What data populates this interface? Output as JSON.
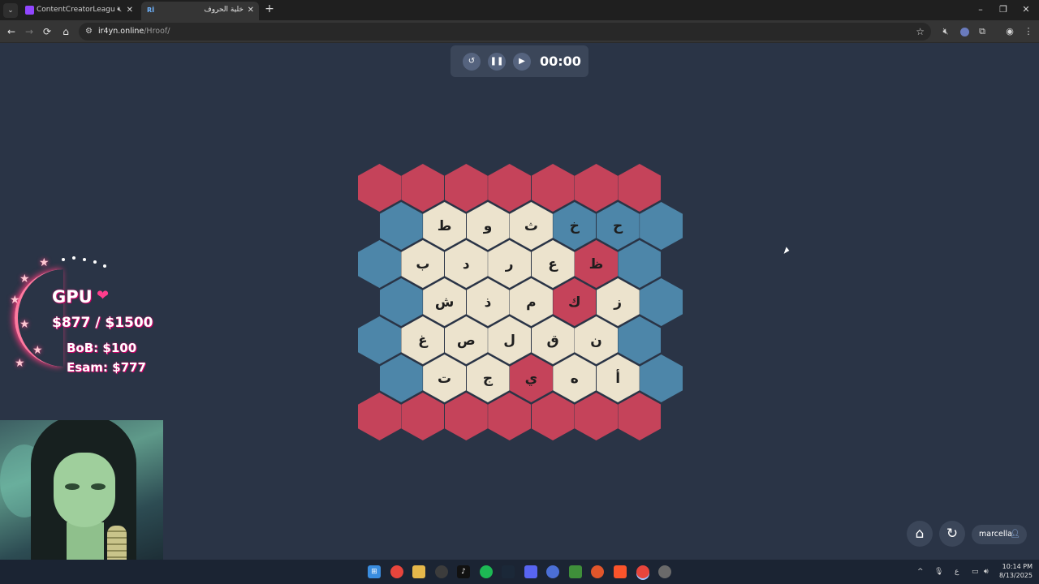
{
  "browser": {
    "tabs": [
      {
        "title": "ContentCreatorLeague - Tw",
        "active": false,
        "muted": true
      },
      {
        "title": "خلية الحروف",
        "active": true
      }
    ],
    "address": {
      "domain": "ir4yn.online",
      "path": "/Hroof/"
    }
  },
  "timer": {
    "time": "00:00"
  },
  "board": {
    "colors": {
      "red": "#c5435a",
      "blue": "#4d86a9",
      "cream": "#ece3cd"
    },
    "rows": [
      [
        {
          "c": "red",
          "t": ""
        },
        {
          "c": "red",
          "t": ""
        },
        {
          "c": "red",
          "t": ""
        },
        {
          "c": "red",
          "t": ""
        },
        {
          "c": "red",
          "t": ""
        },
        {
          "c": "red",
          "t": ""
        },
        {
          "c": "red",
          "t": ""
        }
      ],
      [
        {
          "c": "blue",
          "t": ""
        },
        {
          "c": "cream",
          "t": "ط"
        },
        {
          "c": "cream",
          "t": "و"
        },
        {
          "c": "cream",
          "t": "ث"
        },
        {
          "c": "blue",
          "t": "خ"
        },
        {
          "c": "blue",
          "t": "ح"
        },
        {
          "c": "blue",
          "t": ""
        }
      ],
      [
        {
          "c": "blue",
          "t": ""
        },
        {
          "c": "cream",
          "t": "ب"
        },
        {
          "c": "cream",
          "t": "د"
        },
        {
          "c": "cream",
          "t": "ر"
        },
        {
          "c": "cream",
          "t": "ع"
        },
        {
          "c": "red",
          "t": "ظ"
        },
        {
          "c": "blue",
          "t": ""
        }
      ],
      [
        {
          "c": "blue",
          "t": ""
        },
        {
          "c": "cream",
          "t": "ش"
        },
        {
          "c": "cream",
          "t": "ذ"
        },
        {
          "c": "cream",
          "t": "م"
        },
        {
          "c": "red",
          "t": "ك"
        },
        {
          "c": "cream",
          "t": "ز"
        },
        {
          "c": "blue",
          "t": ""
        }
      ],
      [
        {
          "c": "blue",
          "t": ""
        },
        {
          "c": "cream",
          "t": "غ"
        },
        {
          "c": "cream",
          "t": "ص"
        },
        {
          "c": "cream",
          "t": "ل"
        },
        {
          "c": "cream",
          "t": "ق"
        },
        {
          "c": "cream",
          "t": "ن"
        },
        {
          "c": "blue",
          "t": ""
        }
      ],
      [
        {
          "c": "blue",
          "t": ""
        },
        {
          "c": "cream",
          "t": "ت"
        },
        {
          "c": "cream",
          "t": "ج"
        },
        {
          "c": "red",
          "t": "ي"
        },
        {
          "c": "cream",
          "t": "ه"
        },
        {
          "c": "cream",
          "t": "أ"
        },
        {
          "c": "blue",
          "t": ""
        }
      ],
      [
        {
          "c": "red",
          "t": ""
        },
        {
          "c": "red",
          "t": ""
        },
        {
          "c": "red",
          "t": ""
        },
        {
          "c": "red",
          "t": ""
        },
        {
          "c": "red",
          "t": ""
        },
        {
          "c": "red",
          "t": ""
        },
        {
          "c": "red",
          "t": ""
        }
      ]
    ]
  },
  "overlay": {
    "gpu_label": "GPU",
    "gpu_value": "$877 / $1500",
    "bob": "BoB: $100",
    "esam": "Esam: $777"
  },
  "user": {
    "name": "marcella"
  },
  "clock": {
    "time": "10:14 PM",
    "date": "8/13/2025"
  }
}
